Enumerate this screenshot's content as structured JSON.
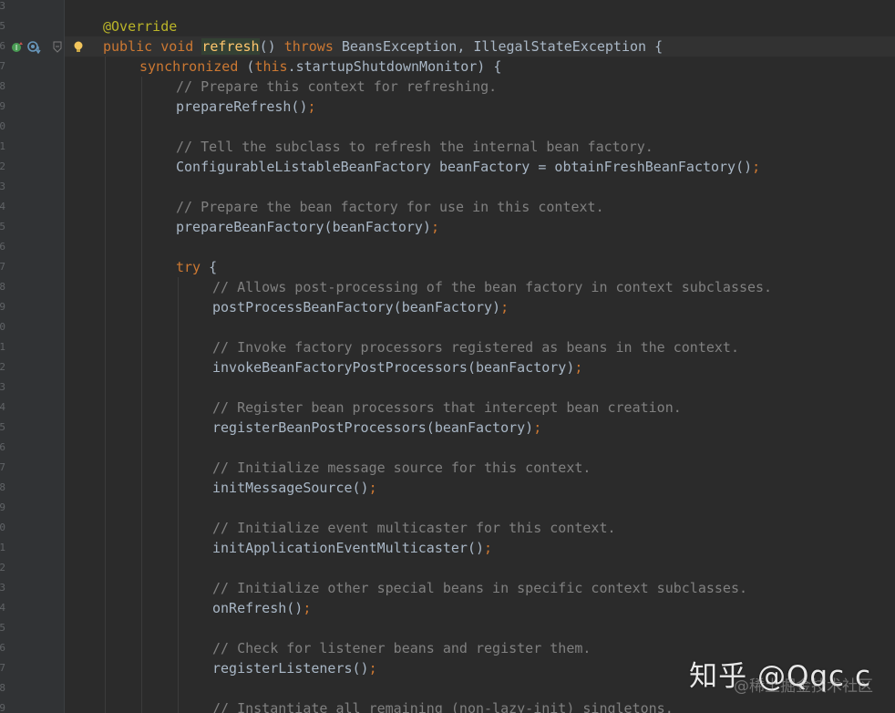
{
  "colors": {
    "background": "#2b2b2b",
    "gutter": "#313335",
    "keyword": "#cc7832",
    "annotation": "#bbb529",
    "comment": "#808080",
    "method_decl": "#ffc66d",
    "plain": "#a9b7c6"
  },
  "gutter": {
    "line_numbers": [
      "3",
      "5",
      "6",
      "7",
      "8",
      "9",
      "0",
      "1",
      "2",
      "3",
      "4",
      "5",
      "6",
      "7",
      "8",
      "9",
      "0",
      "1",
      "2",
      "3",
      "4",
      "5",
      "6",
      "7",
      "8",
      "9",
      "0",
      "1",
      "2",
      "3",
      "4",
      "5",
      "6",
      "7",
      "8",
      "9",
      "0"
    ],
    "icons": [
      "implements-up-icon",
      "override-down-icon",
      "fold-icon",
      "intention-bulb-icon"
    ]
  },
  "code_lines": [
    {
      "indent": 0,
      "tokens": []
    },
    {
      "indent": 0,
      "tokens": [
        {
          "t": "@Override",
          "c": "ann"
        }
      ]
    },
    {
      "indent": 0,
      "current": true,
      "tokens": [
        {
          "t": "public ",
          "c": "kw"
        },
        {
          "t": "void ",
          "c": "kw"
        },
        {
          "t": "refresh",
          "c": "hl"
        },
        {
          "t": "() ",
          "c": "pl"
        },
        {
          "t": "throws ",
          "c": "kw"
        },
        {
          "t": "BeansException, IllegalStateException {",
          "c": "pl"
        }
      ]
    },
    {
      "indent": 1,
      "tokens": [
        {
          "t": "synchronized ",
          "c": "kw"
        },
        {
          "t": "(",
          "c": "pl"
        },
        {
          "t": "this",
          "c": "kw"
        },
        {
          "t": ".startupShutdownMonitor) {",
          "c": "pl"
        }
      ]
    },
    {
      "indent": 2,
      "tokens": [
        {
          "t": "// Prepare this context for refreshing.",
          "c": "cm"
        }
      ]
    },
    {
      "indent": 2,
      "tokens": [
        {
          "t": "prepareRefresh()",
          "c": "pl"
        },
        {
          "t": ";",
          "c": "pu"
        }
      ]
    },
    {
      "indent": 0,
      "tokens": []
    },
    {
      "indent": 2,
      "tokens": [
        {
          "t": "// Tell the subclass to refresh the internal bean factory.",
          "c": "cm"
        }
      ]
    },
    {
      "indent": 2,
      "tokens": [
        {
          "t": "ConfigurableListableBeanFactory beanFactory = obtainFreshBeanFactory()",
          "c": "pl"
        },
        {
          "t": ";",
          "c": "pu"
        }
      ]
    },
    {
      "indent": 0,
      "tokens": []
    },
    {
      "indent": 2,
      "tokens": [
        {
          "t": "// Prepare the bean factory for use in this context.",
          "c": "cm"
        }
      ]
    },
    {
      "indent": 2,
      "tokens": [
        {
          "t": "prepareBeanFactory(beanFactory)",
          "c": "pl"
        },
        {
          "t": ";",
          "c": "pu"
        }
      ]
    },
    {
      "indent": 0,
      "tokens": []
    },
    {
      "indent": 2,
      "tokens": [
        {
          "t": "try ",
          "c": "kw"
        },
        {
          "t": "{",
          "c": "pl"
        }
      ]
    },
    {
      "indent": 3,
      "tokens": [
        {
          "t": "// Allows post-processing of the bean factory in context subclasses.",
          "c": "cm"
        }
      ]
    },
    {
      "indent": 3,
      "tokens": [
        {
          "t": "postProcessBeanFactory(beanFactory)",
          "c": "pl"
        },
        {
          "t": ";",
          "c": "pu"
        }
      ]
    },
    {
      "indent": 0,
      "tokens": []
    },
    {
      "indent": 3,
      "tokens": [
        {
          "t": "// Invoke factory processors registered as beans in the context.",
          "c": "cm"
        }
      ]
    },
    {
      "indent": 3,
      "tokens": [
        {
          "t": "invokeBeanFactoryPostProcessors(beanFactory)",
          "c": "pl"
        },
        {
          "t": ";",
          "c": "pu"
        }
      ]
    },
    {
      "indent": 0,
      "tokens": []
    },
    {
      "indent": 3,
      "tokens": [
        {
          "t": "// Register bean processors that intercept bean creation.",
          "c": "cm"
        }
      ]
    },
    {
      "indent": 3,
      "tokens": [
        {
          "t": "registerBeanPostProcessors(beanFactory)",
          "c": "pl"
        },
        {
          "t": ";",
          "c": "pu"
        }
      ]
    },
    {
      "indent": 0,
      "tokens": []
    },
    {
      "indent": 3,
      "tokens": [
        {
          "t": "// Initialize message source for this context.",
          "c": "cm"
        }
      ]
    },
    {
      "indent": 3,
      "tokens": [
        {
          "t": "initMessageSource()",
          "c": "pl"
        },
        {
          "t": ";",
          "c": "pu"
        }
      ]
    },
    {
      "indent": 0,
      "tokens": []
    },
    {
      "indent": 3,
      "tokens": [
        {
          "t": "// Initialize event multicaster for this context.",
          "c": "cm"
        }
      ]
    },
    {
      "indent": 3,
      "tokens": [
        {
          "t": "initApplicationEventMulticaster()",
          "c": "pl"
        },
        {
          "t": ";",
          "c": "pu"
        }
      ]
    },
    {
      "indent": 0,
      "tokens": []
    },
    {
      "indent": 3,
      "tokens": [
        {
          "t": "// Initialize other special beans in specific context subclasses.",
          "c": "cm"
        }
      ]
    },
    {
      "indent": 3,
      "tokens": [
        {
          "t": "onRefresh()",
          "c": "pl"
        },
        {
          "t": ";",
          "c": "pu"
        }
      ]
    },
    {
      "indent": 0,
      "tokens": []
    },
    {
      "indent": 3,
      "tokens": [
        {
          "t": "// Check for listener beans and register them.",
          "c": "cm"
        }
      ]
    },
    {
      "indent": 3,
      "tokens": [
        {
          "t": "registerListeners()",
          "c": "pl"
        },
        {
          "t": ";",
          "c": "pu"
        }
      ]
    },
    {
      "indent": 0,
      "tokens": []
    },
    {
      "indent": 3,
      "tokens": [
        {
          "t": "// Instantiate all remaining (non-lazy-init) singletons.",
          "c": "cm"
        }
      ]
    }
  ],
  "watermark": {
    "main": "知乎 @Qqc c",
    "sub": "@稀土掘金技术社区"
  }
}
